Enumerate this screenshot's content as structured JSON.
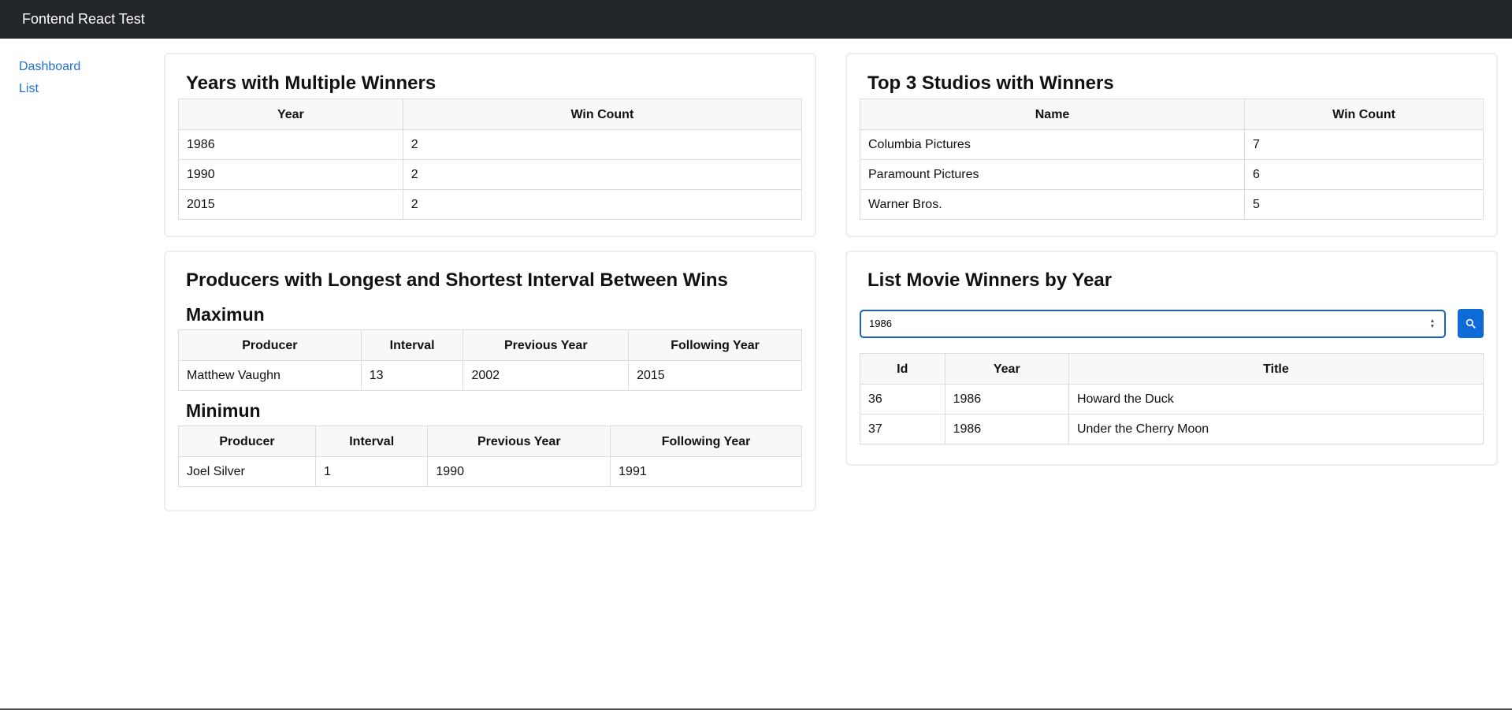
{
  "app": {
    "title": "Fontend React Test"
  },
  "sidebar": {
    "items": [
      {
        "label": "Dashboard"
      },
      {
        "label": "List"
      }
    ]
  },
  "multiple_winners": {
    "title": "Years with Multiple Winners",
    "columns": [
      "Year",
      "Win Count"
    ],
    "rows": [
      [
        "1986",
        "2"
      ],
      [
        "1990",
        "2"
      ],
      [
        "2015",
        "2"
      ]
    ]
  },
  "top_studios": {
    "title": "Top 3 Studios with Winners",
    "columns": [
      "Name",
      "Win Count"
    ],
    "rows": [
      [
        "Columbia Pictures",
        "7"
      ],
      [
        "Paramount Pictures",
        "6"
      ],
      [
        "Warner Bros.",
        "5"
      ]
    ]
  },
  "intervals": {
    "title": "Producers with Longest and Shortest Interval Between Wins",
    "max": {
      "heading": "Maximun",
      "columns": [
        "Producer",
        "Interval",
        "Previous Year",
        "Following Year"
      ],
      "rows": [
        [
          "Matthew Vaughn",
          "13",
          "2002",
          "2015"
        ]
      ]
    },
    "min": {
      "heading": "Minimun",
      "columns": [
        "Producer",
        "Interval",
        "Previous Year",
        "Following Year"
      ],
      "rows": [
        [
          "Joel Silver",
          "1",
          "1990",
          "1991"
        ]
      ]
    }
  },
  "winners_by_year": {
    "title": "List Movie Winners by Year",
    "search": {
      "value": "1986",
      "icon": "search-icon",
      "button_color": "#0d6ad6"
    },
    "columns": [
      "Id",
      "Year",
      "Title"
    ],
    "rows": [
      [
        "36",
        "1986",
        "Howard the Duck"
      ],
      [
        "37",
        "1986",
        "Under the Cherry Moon"
      ]
    ]
  },
  "colors": {
    "navbar": "#222529",
    "link": "#1f6fd6",
    "accent": "#0d6ad6"
  }
}
